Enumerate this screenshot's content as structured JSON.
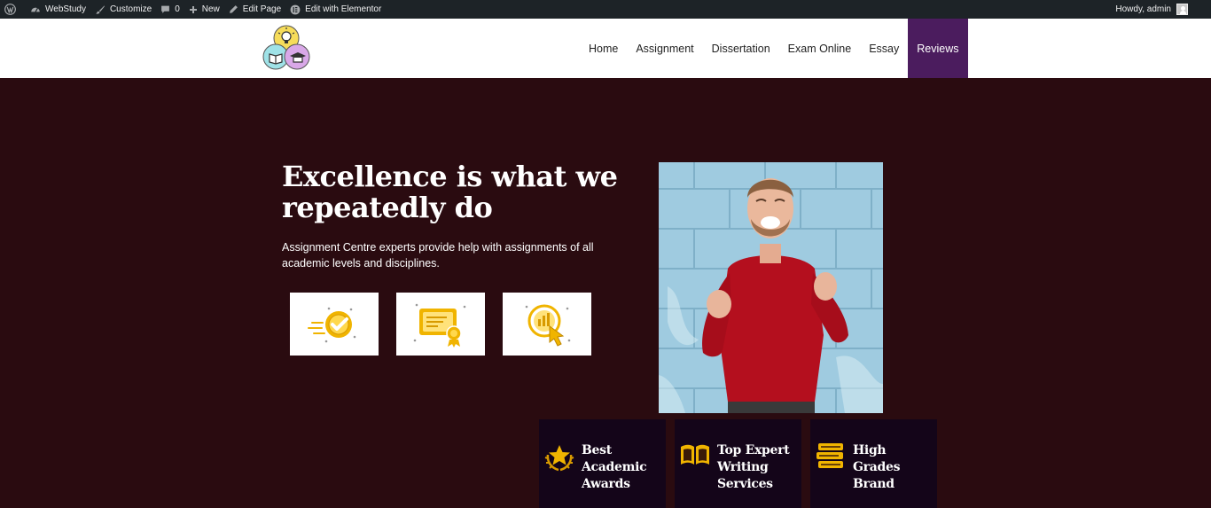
{
  "admin_bar": {
    "site_name": "WebStudy",
    "customize": "Customize",
    "comments_count": "0",
    "new": "New",
    "edit_page": "Edit Page",
    "edit_elementor": "Edit with Elementor",
    "howdy": "Howdy, admin"
  },
  "nav": {
    "items": [
      "Home",
      "Assignment",
      "Dissertation",
      "Exam Online",
      "Essay",
      "Reviews"
    ],
    "active": "Reviews"
  },
  "hero": {
    "title": "Excellence is what we repeatedly do",
    "text": "Assignment Centre experts provide help with assignments of all academic levels and disciplines."
  },
  "feature_icons": [
    "checkmark-speed-icon",
    "certificate-icon",
    "chart-click-icon"
  ],
  "cards": [
    {
      "label": "Best Academic Awards",
      "icon": "star-laurel-icon"
    },
    {
      "label": "Top Expert Writing Services",
      "icon": "open-book-icon"
    },
    {
      "label": "High Grades Brand",
      "icon": "book-stack-icon"
    }
  ],
  "colors": {
    "admin_bar": "#1d2327",
    "hero_bg": "#2a0b10",
    "nav_active": "#4b1c5e",
    "card_bg": "#140519",
    "accent_gold": "#f0b400"
  }
}
